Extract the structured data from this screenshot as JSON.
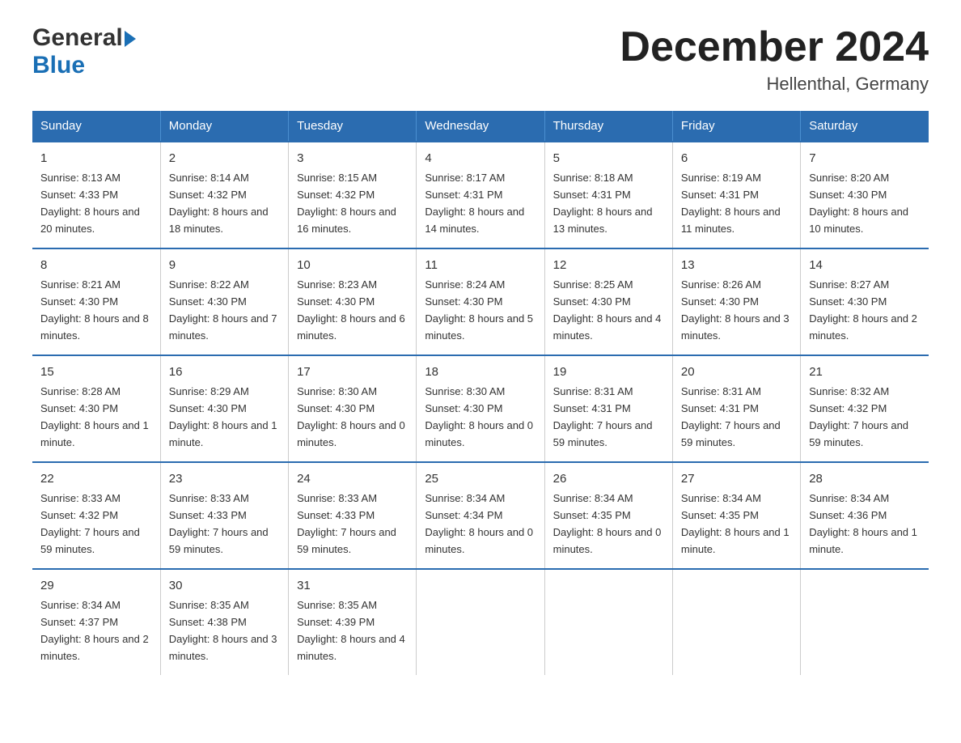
{
  "header": {
    "title": "December 2024",
    "subtitle": "Hellenthal, Germany",
    "logo_general": "General",
    "logo_blue": "Blue"
  },
  "days_of_week": [
    "Sunday",
    "Monday",
    "Tuesday",
    "Wednesday",
    "Thursday",
    "Friday",
    "Saturday"
  ],
  "weeks": [
    [
      {
        "day": "1",
        "sunrise": "8:13 AM",
        "sunset": "4:33 PM",
        "daylight": "8 hours and 20 minutes."
      },
      {
        "day": "2",
        "sunrise": "8:14 AM",
        "sunset": "4:32 PM",
        "daylight": "8 hours and 18 minutes."
      },
      {
        "day": "3",
        "sunrise": "8:15 AM",
        "sunset": "4:32 PM",
        "daylight": "8 hours and 16 minutes."
      },
      {
        "day": "4",
        "sunrise": "8:17 AM",
        "sunset": "4:31 PM",
        "daylight": "8 hours and 14 minutes."
      },
      {
        "day": "5",
        "sunrise": "8:18 AM",
        "sunset": "4:31 PM",
        "daylight": "8 hours and 13 minutes."
      },
      {
        "day": "6",
        "sunrise": "8:19 AM",
        "sunset": "4:31 PM",
        "daylight": "8 hours and 11 minutes."
      },
      {
        "day": "7",
        "sunrise": "8:20 AM",
        "sunset": "4:30 PM",
        "daylight": "8 hours and 10 minutes."
      }
    ],
    [
      {
        "day": "8",
        "sunrise": "8:21 AM",
        "sunset": "4:30 PM",
        "daylight": "8 hours and 8 minutes."
      },
      {
        "day": "9",
        "sunrise": "8:22 AM",
        "sunset": "4:30 PM",
        "daylight": "8 hours and 7 minutes."
      },
      {
        "day": "10",
        "sunrise": "8:23 AM",
        "sunset": "4:30 PM",
        "daylight": "8 hours and 6 minutes."
      },
      {
        "day": "11",
        "sunrise": "8:24 AM",
        "sunset": "4:30 PM",
        "daylight": "8 hours and 5 minutes."
      },
      {
        "day": "12",
        "sunrise": "8:25 AM",
        "sunset": "4:30 PM",
        "daylight": "8 hours and 4 minutes."
      },
      {
        "day": "13",
        "sunrise": "8:26 AM",
        "sunset": "4:30 PM",
        "daylight": "8 hours and 3 minutes."
      },
      {
        "day": "14",
        "sunrise": "8:27 AM",
        "sunset": "4:30 PM",
        "daylight": "8 hours and 2 minutes."
      }
    ],
    [
      {
        "day": "15",
        "sunrise": "8:28 AM",
        "sunset": "4:30 PM",
        "daylight": "8 hours and 1 minute."
      },
      {
        "day": "16",
        "sunrise": "8:29 AM",
        "sunset": "4:30 PM",
        "daylight": "8 hours and 1 minute."
      },
      {
        "day": "17",
        "sunrise": "8:30 AM",
        "sunset": "4:30 PM",
        "daylight": "8 hours and 0 minutes."
      },
      {
        "day": "18",
        "sunrise": "8:30 AM",
        "sunset": "4:30 PM",
        "daylight": "8 hours and 0 minutes."
      },
      {
        "day": "19",
        "sunrise": "8:31 AM",
        "sunset": "4:31 PM",
        "daylight": "7 hours and 59 minutes."
      },
      {
        "day": "20",
        "sunrise": "8:31 AM",
        "sunset": "4:31 PM",
        "daylight": "7 hours and 59 minutes."
      },
      {
        "day": "21",
        "sunrise": "8:32 AM",
        "sunset": "4:32 PM",
        "daylight": "7 hours and 59 minutes."
      }
    ],
    [
      {
        "day": "22",
        "sunrise": "8:33 AM",
        "sunset": "4:32 PM",
        "daylight": "7 hours and 59 minutes."
      },
      {
        "day": "23",
        "sunrise": "8:33 AM",
        "sunset": "4:33 PM",
        "daylight": "7 hours and 59 minutes."
      },
      {
        "day": "24",
        "sunrise": "8:33 AM",
        "sunset": "4:33 PM",
        "daylight": "7 hours and 59 minutes."
      },
      {
        "day": "25",
        "sunrise": "8:34 AM",
        "sunset": "4:34 PM",
        "daylight": "8 hours and 0 minutes."
      },
      {
        "day": "26",
        "sunrise": "8:34 AM",
        "sunset": "4:35 PM",
        "daylight": "8 hours and 0 minutes."
      },
      {
        "day": "27",
        "sunrise": "8:34 AM",
        "sunset": "4:35 PM",
        "daylight": "8 hours and 1 minute."
      },
      {
        "day": "28",
        "sunrise": "8:34 AM",
        "sunset": "4:36 PM",
        "daylight": "8 hours and 1 minute."
      }
    ],
    [
      {
        "day": "29",
        "sunrise": "8:34 AM",
        "sunset": "4:37 PM",
        "daylight": "8 hours and 2 minutes."
      },
      {
        "day": "30",
        "sunrise": "8:35 AM",
        "sunset": "4:38 PM",
        "daylight": "8 hours and 3 minutes."
      },
      {
        "day": "31",
        "sunrise": "8:35 AM",
        "sunset": "4:39 PM",
        "daylight": "8 hours and 4 minutes."
      },
      null,
      null,
      null,
      null
    ]
  ]
}
